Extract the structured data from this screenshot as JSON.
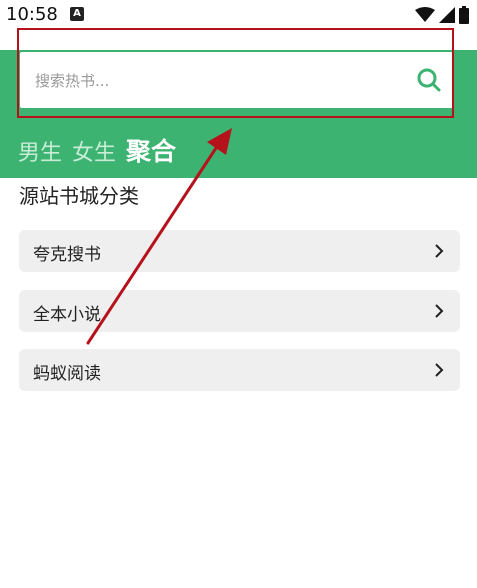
{
  "status": {
    "time": "10:58",
    "notif_icon_letter": "A"
  },
  "search": {
    "placeholder": "搜索热书..."
  },
  "tabs": [
    {
      "label": "男生",
      "active": false
    },
    {
      "label": "女生",
      "active": false
    },
    {
      "label": "聚合",
      "active": true
    }
  ],
  "section": {
    "title": "源站书城分类"
  },
  "sources": [
    {
      "label": "夸克搜书"
    },
    {
      "label": "全本小说"
    },
    {
      "label": "蚂蚁阅读"
    }
  ],
  "colors": {
    "header": "#3cb371",
    "annotation": "#b5121b"
  }
}
